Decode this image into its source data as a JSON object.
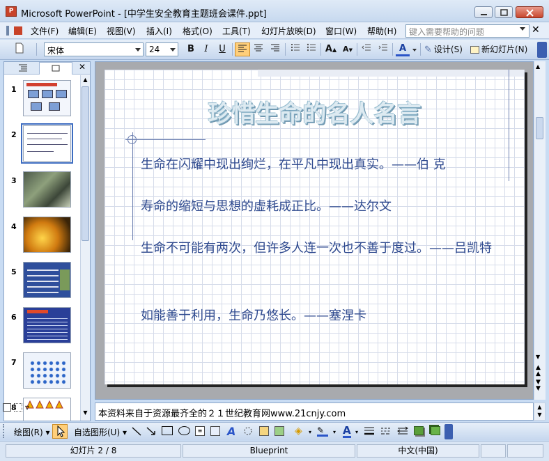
{
  "window": {
    "title": "Microsoft PowerPoint - [中学生安全教育主题班会课件.ppt]",
    "app_icon": "P"
  },
  "menu": {
    "items": [
      "文件(F)",
      "编辑(E)",
      "视图(V)",
      "插入(I)",
      "格式(O)",
      "工具(T)",
      "幻灯片放映(D)",
      "窗口(W)",
      "帮助(H)"
    ],
    "help_placeholder": "键入需要帮助的问题"
  },
  "toolbar": {
    "font_name": "宋体",
    "font_size": "24",
    "bold": "B",
    "italic": "I",
    "underline": "U",
    "design_label": "设计(S)",
    "new_slide_label": "新幻灯片(N)",
    "font_color_letter": "A"
  },
  "slides_panel": {
    "slide_numbers": [
      "1",
      "2",
      "3",
      "4",
      "5",
      "6",
      "7",
      "8"
    ],
    "selected": 2
  },
  "slide": {
    "title": "珍惜生命的名人名言",
    "quotes": [
      "生命在闪耀中现出绚烂，在平凡中现出真实。——伯 克",
      "寿命的缩短与思想的虚耗成正比。——达尔文",
      "生命不可能有两次，但许多人连一次也不善于度过。——吕凯特",
      "如能善于利用，生命乃悠长。——塞涅卡"
    ]
  },
  "notes": {
    "text": "本资料来自于资源最齐全的２１世纪教育网www.21cnjy.com"
  },
  "drawing_toolbar": {
    "draw_label": "绘图(R)",
    "autoshapes_label": "自选图形(U)"
  },
  "status": {
    "slide_info": "幻灯片 2 / 8",
    "design": "Blueprint",
    "language": "中文(中国)"
  },
  "colors": {
    "quote_text": "#2f4a8f",
    "title_outline": "#7ca7bf",
    "selection": "#3d6cc0"
  }
}
